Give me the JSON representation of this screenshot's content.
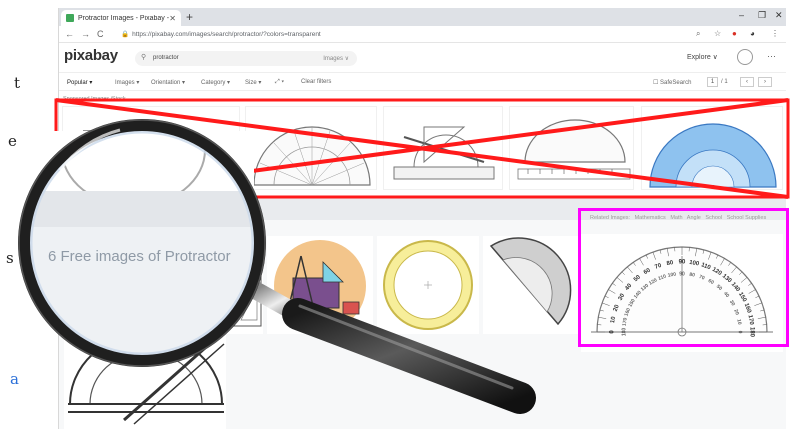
{
  "side_letters": [
    "t",
    "e",
    "s",
    "a"
  ],
  "browser": {
    "tab_title": "Protractor Images - Pixabay - D",
    "url": "https://pixabay.com/images/search/protractor/?colors=transparent"
  },
  "header": {
    "logo": "pixabay",
    "search_query": "protractor",
    "search_type": "Images ∨",
    "explore": "Explore ∨"
  },
  "filters": {
    "items": [
      "Popular ▾",
      "Images ▾",
      "Orientation ▾",
      "Category ▾",
      "Size ▾",
      "⤢ ▾",
      "Clear filters"
    ],
    "safesearch": "☐ SafeSearch",
    "page_current": "1",
    "page_total": "/ 1"
  },
  "sponsored": {
    "label": "Sponsored Images iStock"
  },
  "results": {
    "magnified_heading": "6 Free images of Protractor"
  },
  "highlighted_image": {
    "tags": [
      "Related Images:",
      "Mathematics",
      "Math",
      "Angle",
      "School",
      "School Supplies"
    ],
    "scale_outer": [
      "0",
      "10",
      "20",
      "30",
      "40",
      "50",
      "60",
      "70",
      "80",
      "90",
      "100",
      "110",
      "120",
      "130",
      "140",
      "150",
      "160",
      "170",
      "180"
    ],
    "scale_inner": [
      "180",
      "170",
      "160",
      "150",
      "140",
      "130",
      "120",
      "110",
      "100",
      "90",
      "80",
      "70",
      "60",
      "50",
      "40",
      "30",
      "20",
      "10",
      "0"
    ]
  },
  "colors": {
    "cross_red": "#ff1a1a",
    "highlight_magenta": "#ff00ff",
    "logo": "#333333"
  },
  "icons": [
    "back-icon",
    "forward-icon",
    "reload-icon",
    "lock-icon",
    "search-icon",
    "star-icon",
    "extension-icon",
    "avatar-icon",
    "menu-dots-icon",
    "magnifying-glass-icon"
  ]
}
